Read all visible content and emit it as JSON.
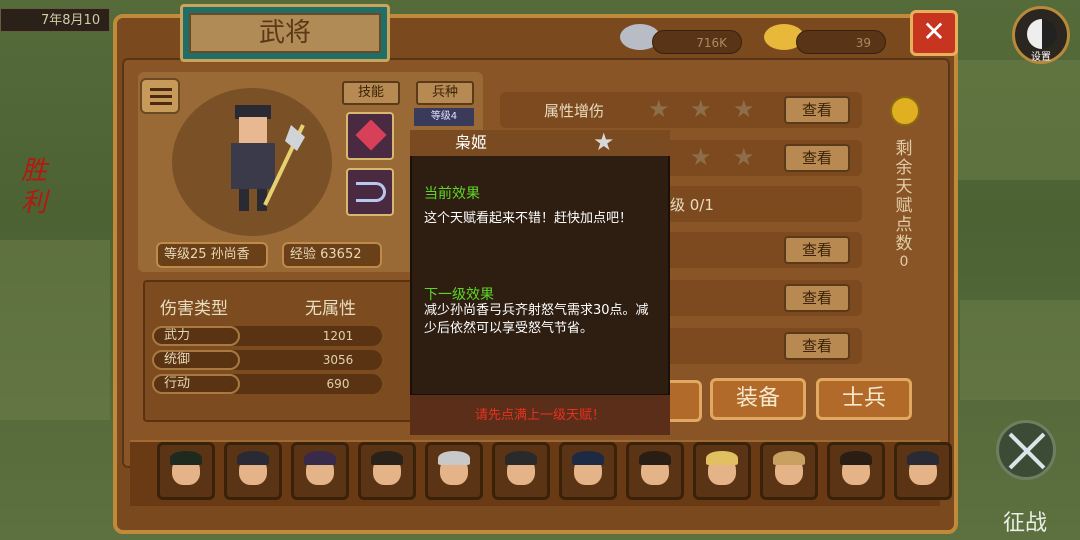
{
  "colors": {
    "tip_heading": "#5ed628",
    "warning": "#e83020",
    "panel": "#8a5526",
    "title_plate": "#1f6e68"
  },
  "top": {
    "date": "7年8月10",
    "window_title": "武将",
    "silver": "716K",
    "gold": "39",
    "settings_label": "设置"
  },
  "side": {
    "victory_label": "胜利",
    "battle_label": "征战"
  },
  "hero": {
    "tab_skill": "技能",
    "tab_troop": "兵种",
    "troop_level": "等级4",
    "level_name": "等级25  孙尚香",
    "exp": "经验 63652",
    "damage_type_label": "伤害类型",
    "damage_type_value": "无属性",
    "stats": [
      {
        "name": "武力",
        "value": "1201"
      },
      {
        "name": "统御",
        "value": "3056"
      },
      {
        "name": "行动",
        "value": "690"
      }
    ]
  },
  "talents": {
    "row1_name": "属性增伤",
    "partial_text": "级 0/1",
    "view_label": "查看",
    "remaining_label": "剩余天赋点数",
    "remaining_value": "0",
    "btn_equip": "装备",
    "btn_soldier": "士兵"
  },
  "tooltip": {
    "title": "枭姬",
    "current_heading": "当前效果",
    "current_text": "这个天赋看起来不错！赶快加点吧！",
    "next_heading": "下一级效果",
    "next_text": "减少孙尚香弓兵齐射怒气需求30点。减少后依然可以享受怒气节省。",
    "warning": "请先点满上一级天赋！"
  },
  "roster": {
    "heroes": [
      "hero-1",
      "hero-2",
      "hero-3",
      "hero-4",
      "hero-5",
      "hero-6",
      "hero-7",
      "hero-8",
      "hero-9",
      "hero-10",
      "hero-11",
      "hero-12"
    ]
  }
}
